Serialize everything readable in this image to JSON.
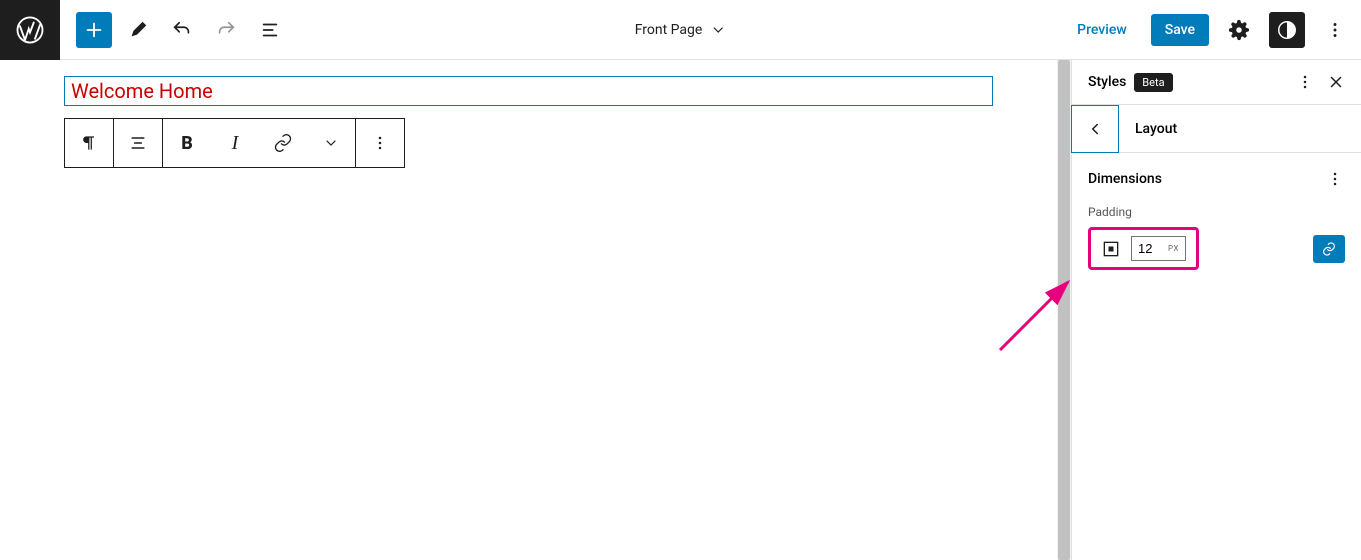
{
  "header": {
    "document_title": "Front Page",
    "preview_label": "Preview",
    "save_label": "Save"
  },
  "editor": {
    "title_content": "Welcome Home"
  },
  "sidebar": {
    "panel_title": "Styles",
    "beta_label": "Beta",
    "nav_section": "Layout",
    "section_dimensions": "Dimensions",
    "padding_label": "Padding",
    "padding_value": "12",
    "padding_unit": "PX"
  },
  "colors": {
    "accent": "#007cba",
    "text_danger": "#cc0000",
    "highlight": "#e6007e"
  },
  "icons": {
    "wp_logo": "wordpress",
    "add": "plus",
    "edit": "pencil",
    "undo": "undo",
    "redo": "redo",
    "listview": "list",
    "chevron_down": "chevron-down",
    "settings": "gear",
    "styles": "contrast",
    "more": "dots-vertical",
    "close": "x",
    "back": "chevron-left",
    "paragraph": "pilcrow",
    "align": "align-left",
    "bold": "B",
    "italic": "I",
    "link": "link",
    "box": "box-model"
  }
}
